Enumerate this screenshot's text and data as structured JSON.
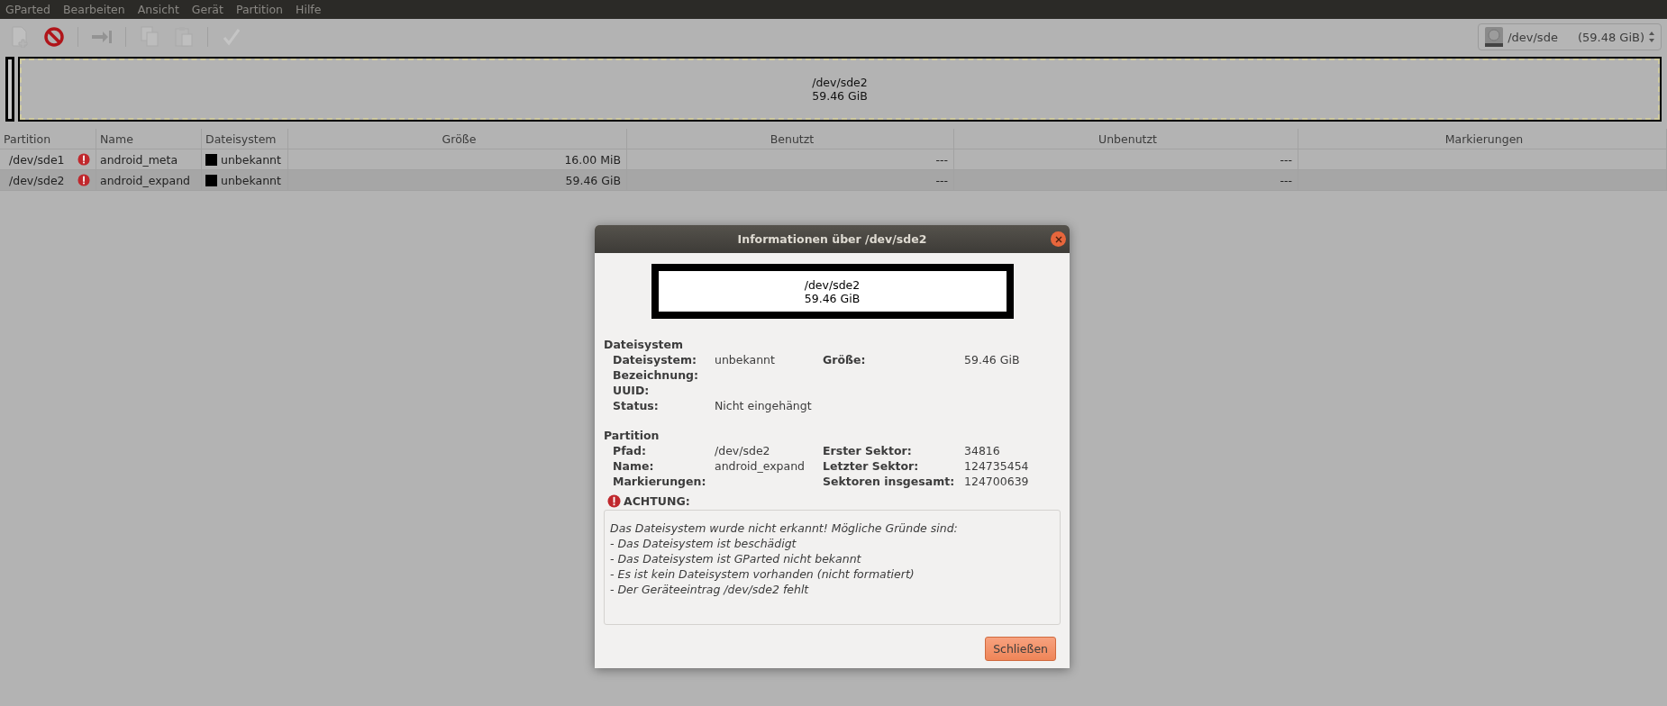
{
  "menu": [
    "GParted",
    "Bearbeiten",
    "Ansicht",
    "Gerät",
    "Partition",
    "Hilfe"
  ],
  "toolbar": [
    {
      "kind": "new",
      "disabled": true
    },
    {
      "kind": "delete",
      "disabled": false
    },
    {
      "kind": "sep"
    },
    {
      "kind": "resize",
      "disabled": true
    },
    {
      "kind": "sep"
    },
    {
      "kind": "copy",
      "disabled": true
    },
    {
      "kind": "paste",
      "disabled": true
    },
    {
      "kind": "sep"
    },
    {
      "kind": "apply",
      "disabled": true
    }
  ],
  "device": {
    "name": "/dev/sde",
    "size": "(59.48 GiB)"
  },
  "disk_map": {
    "label": "/dev/sde2",
    "size": "59.46 GiB",
    "selected": true
  },
  "table": {
    "columns": [
      "Partition",
      "Name",
      "Dateisystem",
      "Größe",
      "Benutzt",
      "Unbenutzt",
      "Markierungen"
    ],
    "rows": [
      {
        "partition": "/dev/sde1",
        "warning": true,
        "name": "android_meta",
        "color": "#000000",
        "filesystem": "unbekannt",
        "size": "16.00 MiB",
        "used": "---",
        "unused": "---",
        "selected": false
      },
      {
        "partition": "/dev/sde2",
        "warning": true,
        "name": "android_expand",
        "color": "#000000",
        "filesystem": "unbekannt",
        "size": "59.46 GiB",
        "used": "---",
        "unused": "---",
        "selected": true
      }
    ]
  },
  "dialog": {
    "title": "Informationen über /dev/sde2",
    "graphic": {
      "label": "/dev/sde2",
      "size": "59.46 GiB"
    },
    "sections": [
      {
        "title": "Dateisystem",
        "rows": [
          {
            "label": "Dateisystem:",
            "value": "unbekannt",
            "label2": "Größe:",
            "value2": "59.46 GiB"
          },
          {
            "label": "Bezeichnung:"
          },
          {
            "label": "UUID:"
          },
          {
            "label": "Status:",
            "value": "Nicht eingehängt"
          }
        ]
      },
      {
        "title": "Partition",
        "rows": [
          {
            "label": "Pfad:",
            "value": "/dev/sde2",
            "label2": "Erster Sektor:",
            "value2": "34816"
          },
          {
            "label": "Name:",
            "value": "android_expand",
            "label2": "Letzter Sektor:",
            "value2": "124735454"
          },
          {
            "label": "Markierungen:",
            "label2": "Sektoren insgesamt:",
            "value2": "124700639"
          }
        ]
      }
    ],
    "warning": {
      "title": "ACHTUNG:",
      "lines": [
        "Das Dateisystem wurde nicht erkannt! Mögliche Gründe sind:",
        "- Das Dateisystem ist beschädigt",
        "- Das Dateisystem ist GParted nicht bekannt",
        "- Es ist kein Dateisystem vorhanden (nicht formatiert)",
        "- Der Geräteeintrag /dev/sde2 fehlt"
      ]
    },
    "button": "Schließen"
  }
}
